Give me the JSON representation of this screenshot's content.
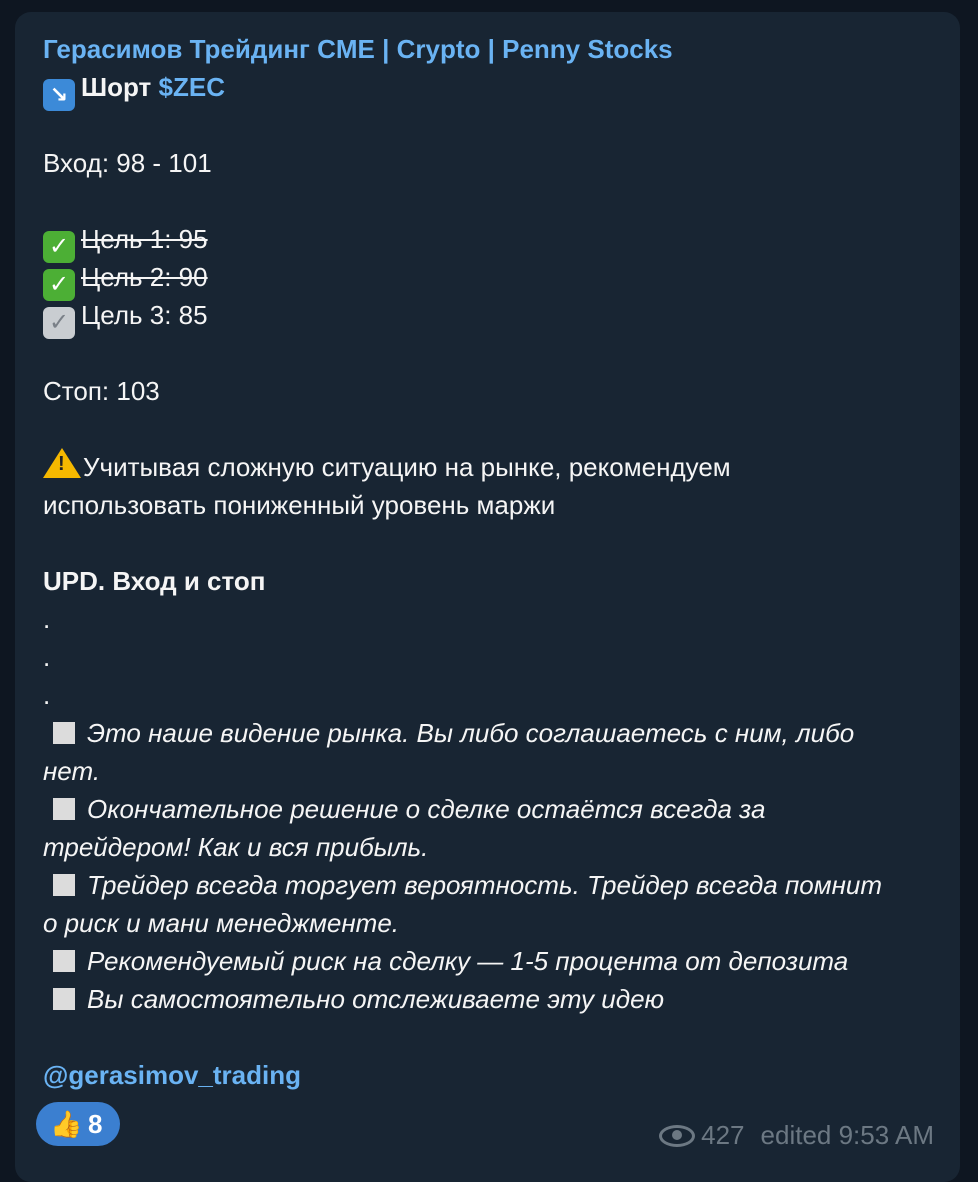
{
  "post": {
    "channel_name": "Герасимов Трейдинг CME | Crypto | Penny Stocks",
    "short_label": "Шорт",
    "ticker": "$ZEC",
    "entry": "Вход: 98 - 101",
    "targets": [
      {
        "label": "Цель 1: 95",
        "status": "done"
      },
      {
        "label": "Цель 2: 90",
        "status": "done"
      },
      {
        "label": "Цель 3: 85",
        "status": "pending"
      }
    ],
    "stop": "Стоп: 103",
    "warning_line1": "Учитывая сложную ситуацию на рынке, рекомендуем",
    "warning_line2": "использовать пониженный уровень маржи",
    "update": "UPD. Вход и стоп",
    "dots": [
      ".",
      ".",
      "."
    ],
    "disclaimers": [
      "Это наше видение рынка. Вы либо соглашаетесь с ним, либо",
      "нет.",
      "Окончательное решение о сделке остаётся всегда за",
      "трейдером! Как и вся прибыль.",
      "Трейдер всегда торгует вероятность. Трейдер всегда помнит",
      "о риск и мани менеджменте.",
      "Рекомендуемый риск на сделку — 1-5 процента от депозита",
      "Вы самостоятельно отслеживаете эту идею"
    ],
    "handle": "@gerasimov_trading"
  },
  "reaction": {
    "emoji": "👍",
    "count": "8"
  },
  "meta": {
    "views": "427",
    "edited": "edited 9:53 AM"
  },
  "icons": {
    "arrow": "down-right-arrow-icon",
    "check": "check-mark-icon",
    "gray_check": "gray-check-mark-icon",
    "warning": "warning-icon",
    "square": "square-icon",
    "eye": "eye-icon"
  },
  "colors": {
    "background": "#0e1621",
    "bubble": "#182533",
    "link": "#6ab3f3",
    "reaction": "#3b7fd0"
  }
}
